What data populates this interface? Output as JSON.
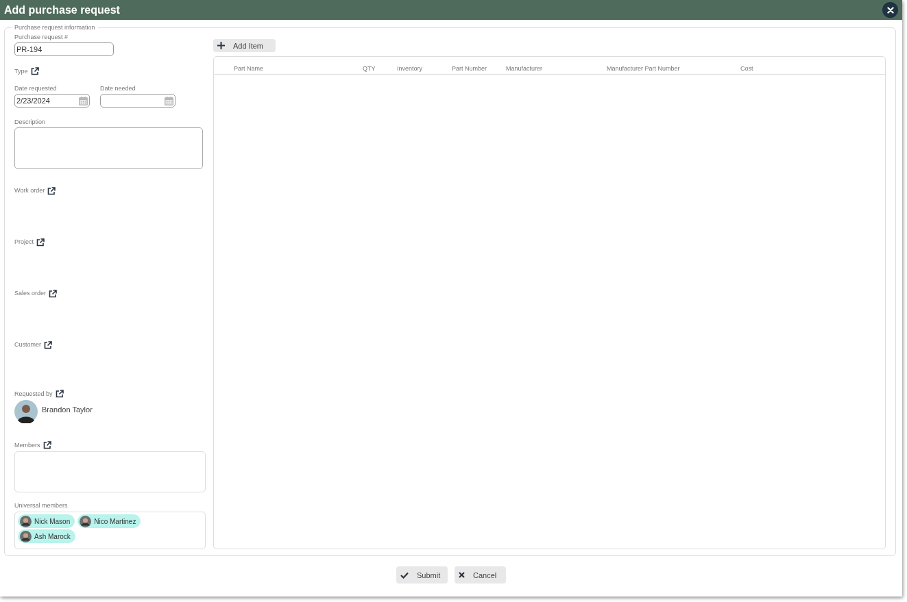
{
  "window": {
    "title": "Add purchase request"
  },
  "section": {
    "legend": "Purchase request information"
  },
  "request_number": {
    "label": "Purchase request #",
    "value": "PR-194"
  },
  "type": {
    "label": "Type"
  },
  "date_requested": {
    "label": "Date requested",
    "value": "2/23/2024"
  },
  "date_needed": {
    "label": "Date needed"
  },
  "description": {
    "label": "Description"
  },
  "links": [
    {
      "label": "Work order"
    },
    {
      "label": "Project"
    },
    {
      "label": "Sales order"
    },
    {
      "label": "Customer"
    }
  ],
  "requested_by": {
    "label": "Requested by",
    "name": "Brandon Taylor"
  },
  "members": {
    "label": "Members"
  },
  "universal_members": {
    "label": "Universal members",
    "people": [
      "Nick Mason",
      "Nico Martinez",
      "Ash Marock"
    ]
  },
  "add_item": {
    "label": "Add Item"
  },
  "table": {
    "columns": [
      "Part Name",
      "QTY",
      "Inventory",
      "Part Number",
      "Manufacturer",
      "Manufacturer Part Number",
      "Cost"
    ]
  },
  "buttons": [
    {
      "kind": "submit",
      "label": "Submit"
    },
    {
      "kind": "cancel",
      "label": "Cancel"
    }
  ]
}
